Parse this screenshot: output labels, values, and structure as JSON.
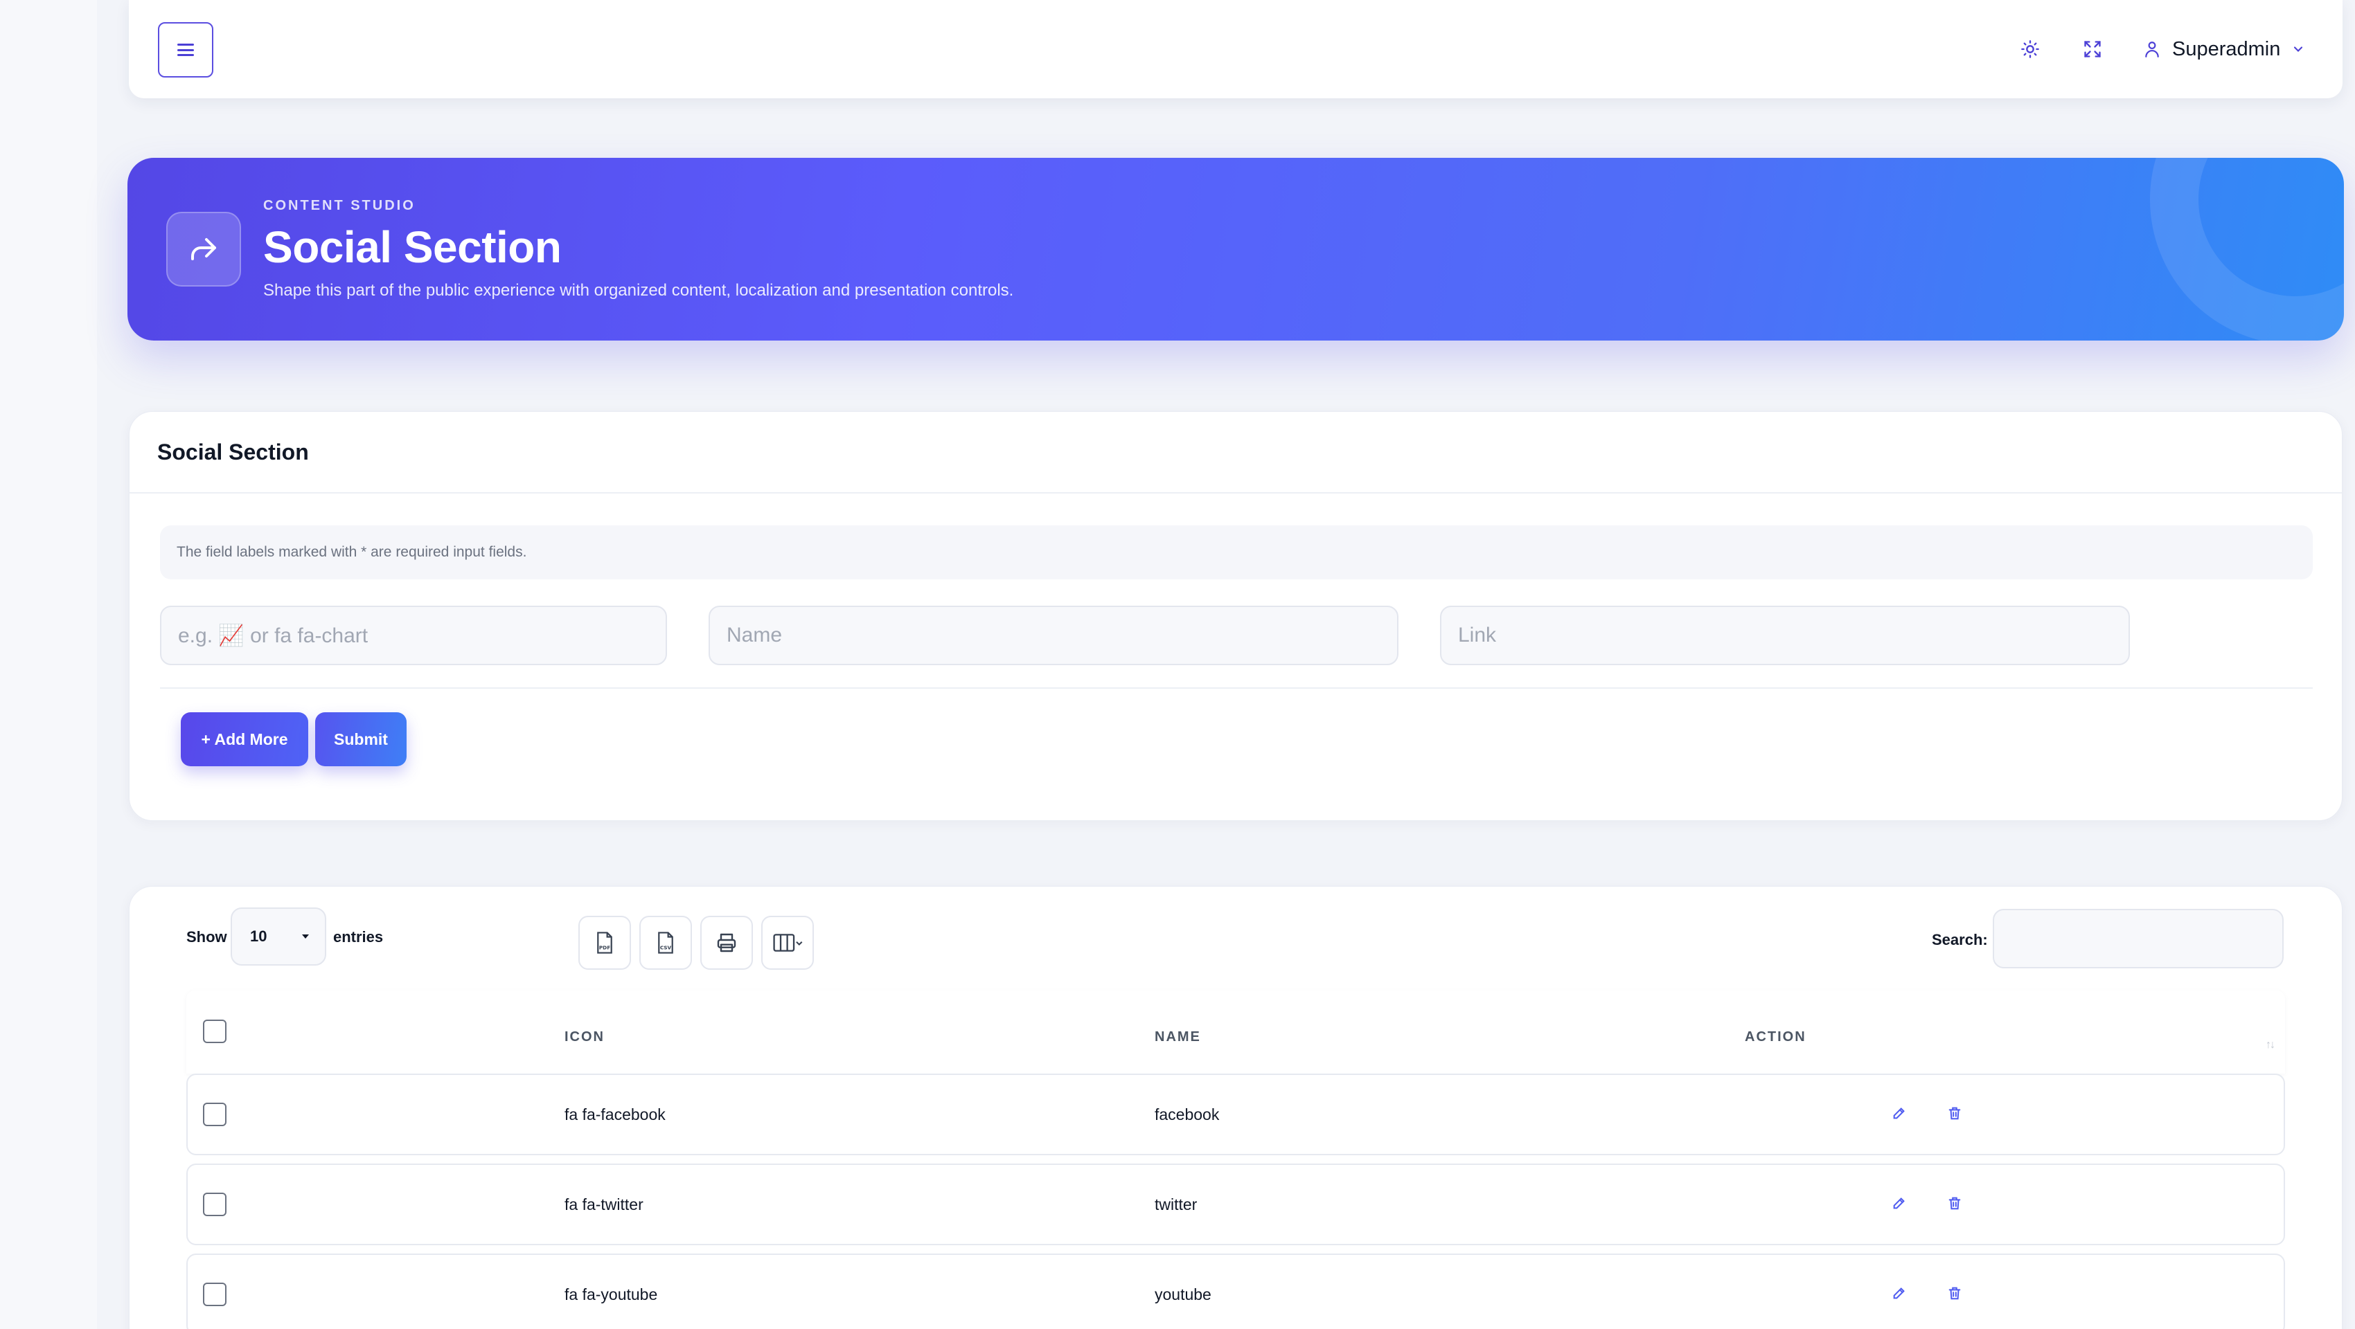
{
  "topbar": {
    "menu_icon": "hamburger-icon",
    "theme_icon": "sun-icon",
    "fullscreen_icon": "fullscreen-icon",
    "user_icon": "user-icon",
    "user_name": "Superadmin"
  },
  "hero": {
    "icon": "share-icon",
    "kicker": "CONTENT STUDIO",
    "title": "Social Section",
    "subtitle": "Shape this part of the public experience with organized content, localization and presentation controls."
  },
  "form": {
    "title": "Social Section",
    "note": "The field labels marked with * are required input fields.",
    "icon_placeholder": "e.g. 📈 or fa fa-chart",
    "name_placeholder": "Name",
    "link_placeholder": "Link",
    "add_more_label": "+ Add More",
    "submit_label": "Submit"
  },
  "table": {
    "show_label": "Show",
    "page_length": "10",
    "entries_label": "entries",
    "search_label": "Search:",
    "tools": [
      "pdf-export-icon",
      "csv-export-icon",
      "print-icon",
      "columns-icon"
    ],
    "columns": [
      "ICON",
      "NAME",
      "ACTION"
    ],
    "rows": [
      {
        "icon": "fa fa-facebook",
        "name": "facebook"
      },
      {
        "icon": "fa fa-twitter",
        "name": "twitter"
      },
      {
        "icon": "fa fa-youtube",
        "name": "youtube"
      }
    ]
  },
  "colors": {
    "accent": "#5447e6",
    "gradient_end": "#2f8cf6",
    "background": "#f2f4f9"
  }
}
